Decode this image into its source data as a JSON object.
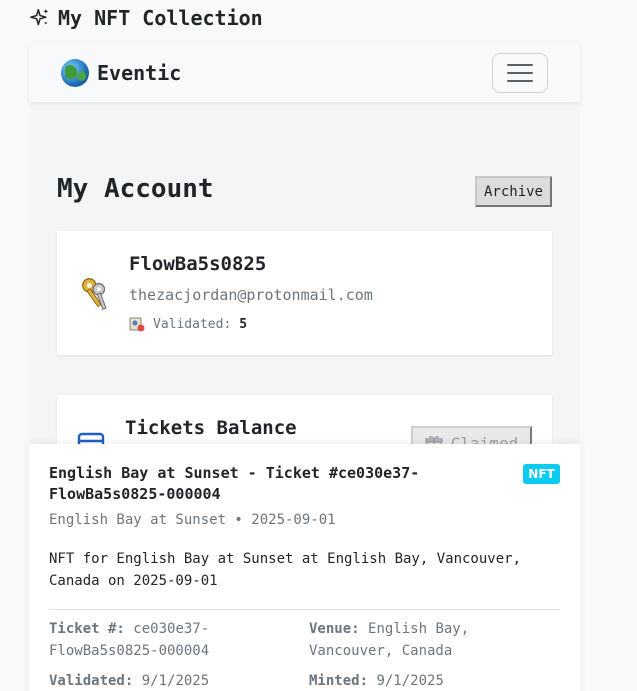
{
  "page": {
    "title": "My NFT Collection"
  },
  "navbar": {
    "brand": "Eventic"
  },
  "account": {
    "title": "My Account",
    "archive_label": "Archive",
    "username": "FlowBa5s0825",
    "email": "thezacjordan@protonmail.com",
    "validated_label": "Validated:",
    "validated_count": "5"
  },
  "tickets": {
    "title": "Tickets Balance",
    "claimed_label": "Claimed"
  },
  "nft": {
    "title": "English Bay at Sunset - Ticket #ce030e37-FlowBa5s0825-000004",
    "badge": "NFT",
    "subtitle": "English Bay at Sunset • 2025-09-01",
    "description": "NFT for English Bay at Sunset at English Bay, Vancouver, Canada on 2025-09-01",
    "ticket_label": "Ticket #:",
    "ticket_value": "ce030e37-FlowBa5s0825-000004",
    "venue_label": "Venue:",
    "venue_value": "English Bay, Vancouver, Canada",
    "validated_label": "Validated:",
    "validated_value": "9/1/2025",
    "minted_label": "Minted:",
    "minted_value": "9/1/2025"
  },
  "icons": {
    "header": "sparkles-icon",
    "brand": "globe-icon",
    "menu": "hamburger-icon",
    "account": "keys-icon",
    "validated": "validated-badge-icon",
    "tickets": "ticket-icon",
    "claimed": "gift-icon"
  },
  "colors": {
    "badge": "#0dcaf0",
    "background": "#f8f9fa"
  }
}
